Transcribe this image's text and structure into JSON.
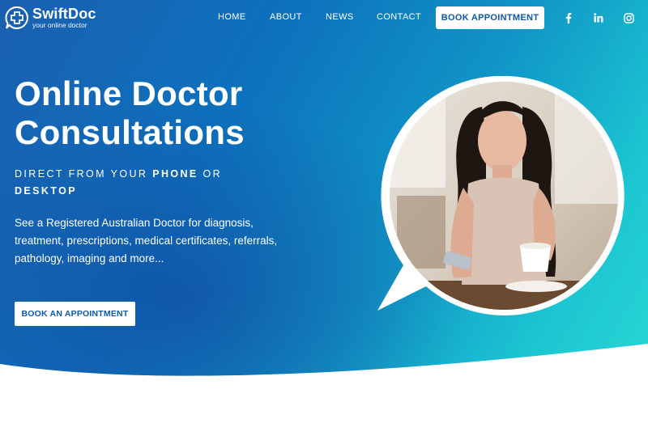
{
  "header": {
    "logo_name": "SwiftDoc",
    "logo_tagline": "your online doctor",
    "nav": [
      {
        "label": "HOME"
      },
      {
        "label": "ABOUT"
      },
      {
        "label": "NEWS"
      },
      {
        "label": "CONTACT"
      }
    ],
    "book_button": "BOOK APPOINTMENT",
    "social": [
      "facebook-icon",
      "linkedin-icon",
      "instagram-icon"
    ]
  },
  "hero": {
    "title_line1": "Online Doctor",
    "title_line2": "Consultations",
    "subtitle_part1": "DIRECT FROM YOUR ",
    "subtitle_bold1": "PHONE",
    "subtitle_part2": " OR ",
    "subtitle_bold2": "DESKTOP",
    "description": "See a Registered Australian Doctor for diagnosis, treatment, prescriptions, medical certificates, referrals, pathology, imaging and more...",
    "cta_label": "BOOK AN APPOINTMENT"
  },
  "colors": {
    "brand_blue": "#0d58a8",
    "gradient_start": "#1a5fb0",
    "gradient_end": "#28d6d4",
    "text_on_hero": "#ffffff"
  }
}
